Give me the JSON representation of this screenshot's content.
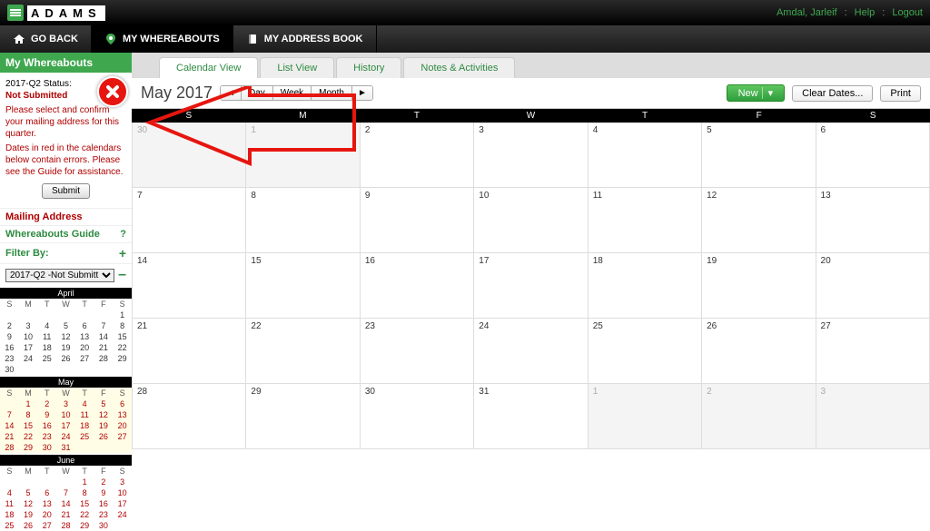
{
  "brand": "ADAMS",
  "topbar": {
    "user": "Amdal, Jarleif",
    "help": "Help",
    "logout": "Logout"
  },
  "nav": {
    "goback": "GO BACK",
    "whereabouts": "MY WHEREABOUTS",
    "addressbook": "MY ADDRESS BOOK"
  },
  "sidebar": {
    "title": "My Whereabouts",
    "status_label": "2017-Q2 Status:",
    "status_value": "Not Submitted",
    "msg1": "Please select and confirm your mailing address for this quarter.",
    "msg2": "Dates in red in the calendars below contain errors. Please see the Guide for assistance.",
    "submit": "Submit",
    "mailing": "Mailing Address",
    "guide": "Whereabouts Guide",
    "filter": "Filter By:",
    "filter_value": "2017-Q2 -Not Submitt"
  },
  "minicals": {
    "april": {
      "title": "April",
      "dow": [
        "S",
        "M",
        "T",
        "W",
        "T",
        "F",
        "S"
      ],
      "rows": [
        [
          "",
          "",
          "",
          "",
          "",
          "",
          "1"
        ],
        [
          "2",
          "3",
          "4",
          "5",
          "6",
          "7",
          "8"
        ],
        [
          "9",
          "10",
          "11",
          "12",
          "13",
          "14",
          "15"
        ],
        [
          "16",
          "17",
          "18",
          "19",
          "20",
          "21",
          "22"
        ],
        [
          "23",
          "24",
          "25",
          "26",
          "27",
          "28",
          "29"
        ],
        [
          "30",
          "",
          "",
          "",
          "",
          "",
          ""
        ]
      ]
    },
    "may": {
      "title": "May",
      "dow": [
        "S",
        "M",
        "T",
        "W",
        "T",
        "F",
        "S"
      ],
      "rows": [
        [
          "",
          "1",
          "2",
          "3",
          "4",
          "5",
          "6"
        ],
        [
          "7",
          "8",
          "9",
          "10",
          "11",
          "12",
          "13"
        ],
        [
          "14",
          "15",
          "16",
          "17",
          "18",
          "19",
          "20"
        ],
        [
          "21",
          "22",
          "23",
          "24",
          "25",
          "26",
          "27"
        ],
        [
          "28",
          "29",
          "30",
          "31",
          "",
          "",
          ""
        ]
      ]
    },
    "june": {
      "title": "June",
      "dow": [
        "S",
        "M",
        "T",
        "W",
        "T",
        "F",
        "S"
      ],
      "rows": [
        [
          "",
          "",
          "",
          "",
          "1",
          "2",
          "3"
        ],
        [
          "4",
          "5",
          "6",
          "7",
          "8",
          "9",
          "10"
        ],
        [
          "11",
          "12",
          "13",
          "14",
          "15",
          "16",
          "17"
        ],
        [
          "18",
          "19",
          "20",
          "21",
          "22",
          "23",
          "24"
        ],
        [
          "25",
          "26",
          "27",
          "28",
          "29",
          "30",
          ""
        ]
      ]
    }
  },
  "tabs": {
    "calendar": "Calendar View",
    "list": "List View",
    "history": "History",
    "notes": "Notes & Activities"
  },
  "controls": {
    "title": "May 2017",
    "day": "Day",
    "week": "Week",
    "month": "Month",
    "new": "New",
    "clear": "Clear Dates...",
    "print": "Print"
  },
  "bigcal": {
    "dow": [
      "S",
      "M",
      "T",
      "W",
      "T",
      "F",
      "S"
    ],
    "rows": [
      [
        {
          "n": "30",
          "o": true
        },
        {
          "n": "1",
          "o": true
        },
        {
          "n": "2"
        },
        {
          "n": "3"
        },
        {
          "n": "4"
        },
        {
          "n": "5"
        },
        {
          "n": "6"
        }
      ],
      [
        {
          "n": "7"
        },
        {
          "n": "8"
        },
        {
          "n": "9"
        },
        {
          "n": "10"
        },
        {
          "n": "11"
        },
        {
          "n": "12"
        },
        {
          "n": "13"
        }
      ],
      [
        {
          "n": "14"
        },
        {
          "n": "15"
        },
        {
          "n": "16"
        },
        {
          "n": "17"
        },
        {
          "n": "18"
        },
        {
          "n": "19"
        },
        {
          "n": "20"
        }
      ],
      [
        {
          "n": "21"
        },
        {
          "n": "22"
        },
        {
          "n": "23"
        },
        {
          "n": "24"
        },
        {
          "n": "25"
        },
        {
          "n": "26"
        },
        {
          "n": "27"
        }
      ],
      [
        {
          "n": "28"
        },
        {
          "n": "29"
        },
        {
          "n": "30"
        },
        {
          "n": "31"
        },
        {
          "n": "1",
          "o": true
        },
        {
          "n": "2",
          "o": true
        },
        {
          "n": "3",
          "o": true
        }
      ]
    ]
  }
}
